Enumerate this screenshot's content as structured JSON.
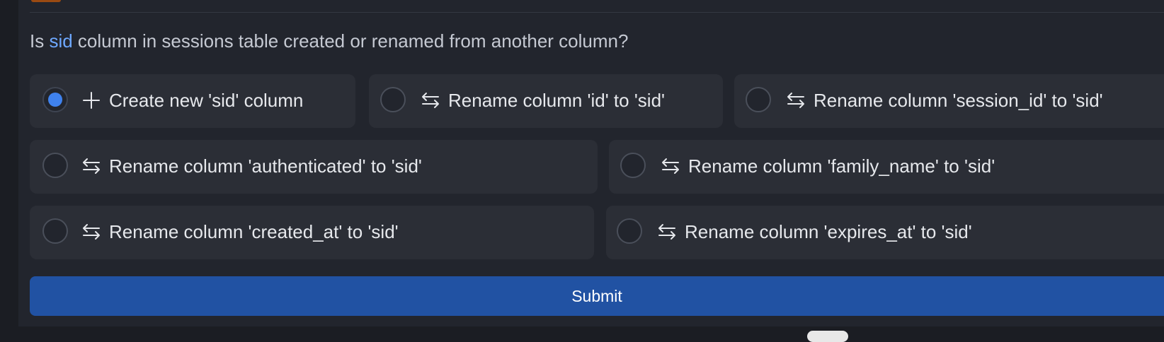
{
  "question": {
    "prefix": "Is ",
    "column": "sid",
    "suffix": " column in sessions table created or renamed from another column?"
  },
  "options": [
    {
      "label": "Create new 'sid' column",
      "icon": "plus-icon",
      "selected": true
    },
    {
      "label": "Rename column 'id' to 'sid'",
      "icon": "swap-arrows-icon",
      "selected": false
    },
    {
      "label": "Rename column 'session_id' to 'sid'",
      "icon": "swap-arrows-icon",
      "selected": false
    },
    {
      "label": "Rename column 'authenticated' to 'sid'",
      "icon": "swap-arrows-icon",
      "selected": false
    },
    {
      "label": "Rename column 'family_name' to 'sid'",
      "icon": "swap-arrows-icon",
      "selected": false
    },
    {
      "label": "Rename column 'created_at' to 'sid'",
      "icon": "swap-arrows-icon",
      "selected": false
    },
    {
      "label": "Rename column 'expires_at' to 'sid'",
      "icon": "swap-arrows-icon",
      "selected": false
    }
  ],
  "submit": {
    "label": "Submit"
  },
  "colors": {
    "accent": "#3f82ee",
    "highlight": "#6ea8ff",
    "submit_bg": "#2152a3",
    "panel_bg": "#22252d",
    "option_bg": "#2b2e36"
  }
}
